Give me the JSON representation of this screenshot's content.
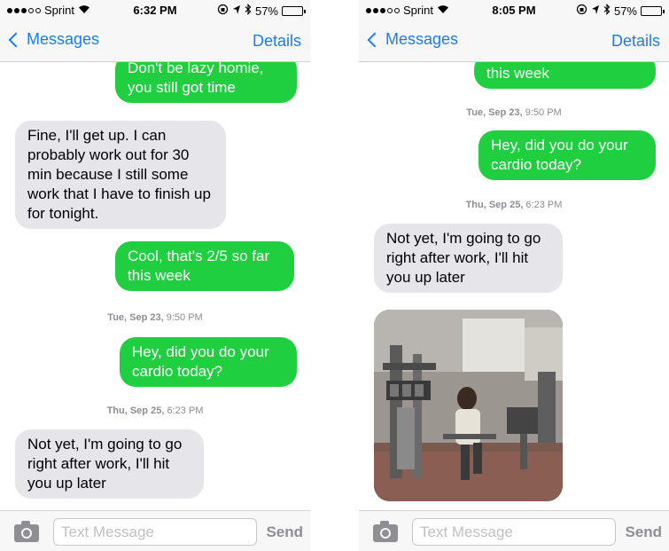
{
  "status_left": {
    "carrier": "Sprint",
    "time": "6:32 PM",
    "battery": "57%",
    "battery_level": 0.57
  },
  "status_right": {
    "carrier": "Sprint",
    "time": "8:05 PM",
    "battery": "57%",
    "battery_level": 0.57
  },
  "nav": {
    "back_label": "Messages",
    "details_label": "Details"
  },
  "compose": {
    "placeholder": "Text Message",
    "send_label": "Send"
  },
  "left_thread": [
    {
      "type": "sent",
      "text": "Don't be lazy homie, you still got time"
    },
    {
      "type": "received",
      "text": "Fine, I'll get up. I can probably work out for 30 min because I still some work that I have to finish up for tonight."
    },
    {
      "type": "sent",
      "text": "Cool, that's 2/5 so far this week"
    },
    {
      "type": "timestamp",
      "day": "Tue, Sep 23,",
      "time": "9:50 PM"
    },
    {
      "type": "sent",
      "text": "Hey, did you do your cardio today?"
    },
    {
      "type": "timestamp",
      "day": "Thu, Sep 25,",
      "time": "6:23 PM"
    },
    {
      "type": "received",
      "text": "Not yet, I'm going to go right after work, I'll hit you up later"
    }
  ],
  "right_thread": [
    {
      "type": "sent",
      "text": "this week"
    },
    {
      "type": "timestamp",
      "day": "Tue, Sep 23,",
      "time": "9:50 PM"
    },
    {
      "type": "sent",
      "text": "Hey, did you do your cardio today?"
    },
    {
      "type": "timestamp",
      "day": "Thu, Sep 25,",
      "time": "6:23 PM"
    },
    {
      "type": "received",
      "text": "Not yet, I'm going to go right after work, I'll hit you up later"
    },
    {
      "type": "image",
      "description": "gym photo"
    }
  ]
}
